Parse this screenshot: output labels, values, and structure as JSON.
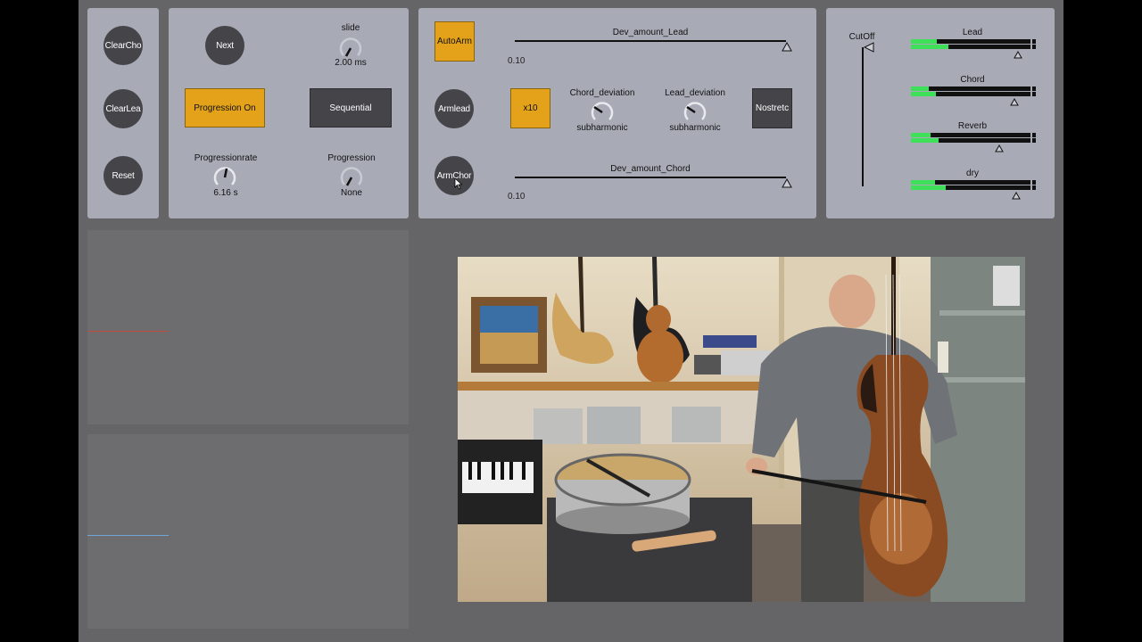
{
  "panel1": {
    "clear_chord": "ClearCho",
    "clear_lead": "ClearLea",
    "reset": "Reset"
  },
  "panel2": {
    "next": "Next",
    "slide_label": "slide",
    "slide_value": "2.00 ms",
    "progression_on": "Progression On",
    "sequential": "Sequential",
    "progressionrate_label": "Progressionrate",
    "progressionrate_value": "6.16 s",
    "progression_label": "Progression",
    "progression_value": "None"
  },
  "panel3": {
    "autoarm": "AutoArm",
    "armlead": "Armlead",
    "armchord": "ArmChor",
    "x10": "x10",
    "nostretch": "Nostretc",
    "dev_lead_label": "Dev_amount_Lead",
    "dev_lead_value": "0.10",
    "dev_chord_label": "Dev_amount_Chord",
    "dev_chord_value": "0.10",
    "chord_dev_label": "Chord_deviation",
    "chord_dev_value": "subharmonic",
    "lead_dev_label": "Lead_deviation",
    "lead_dev_value": "subharmonic"
  },
  "panel4": {
    "cutoff_label": "CutOff",
    "meters": [
      {
        "label": "Lead",
        "level": 0.3
      },
      {
        "label": "Chord",
        "level": 0.2
      },
      {
        "label": "Reverb",
        "level": 0.22
      },
      {
        "label": "dry",
        "level": 0.28
      }
    ]
  },
  "colors": {
    "accent": "#e3a21a",
    "meter_green": "#3ee05a",
    "lead_trace": "#c24a3a",
    "chord_trace": "#6fa6d8"
  },
  "video": {
    "icon": "musician-video-frame"
  }
}
